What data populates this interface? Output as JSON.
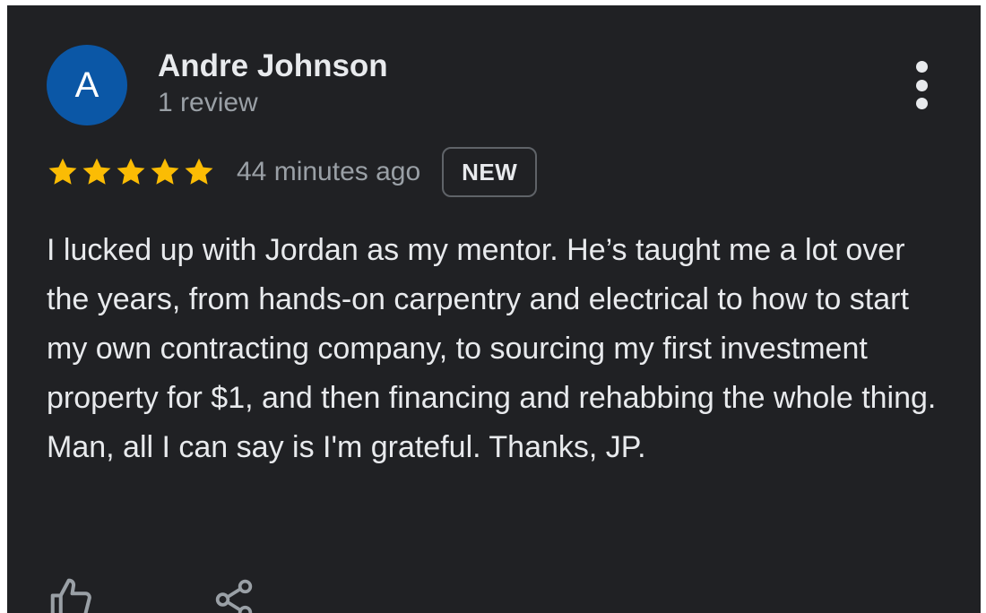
{
  "review": {
    "avatar_letter": "A",
    "reviewer_name": "Andre Johnson",
    "review_count": "1 review",
    "rating": 5,
    "rating_max": 5,
    "timestamp": "44 minutes ago",
    "badge": "NEW",
    "text": "I lucked up with Jordan as my mentor. He’s taught me a lot over the years, from hands-on carpentry and electrical to how to start my own contracting company, to sourcing my first investment property for $1, and then financing and rehabbing the whole thing. Man, all I can say is I'm grateful. Thanks, JP."
  },
  "colors": {
    "background": "#202124",
    "avatar": "#0b57a6",
    "star": "#fbbc04",
    "primary_text": "#e8eaed",
    "secondary_text": "#9aa0a6"
  },
  "icons": {
    "more": "more-vert-icon",
    "like": "thumbs-up-icon",
    "share": "share-icon",
    "star": "star-icon"
  }
}
